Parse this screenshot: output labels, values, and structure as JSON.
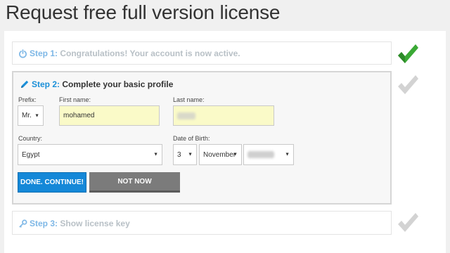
{
  "page": {
    "title": "Request free full version license"
  },
  "steps": {
    "step1": {
      "num": "Step 1:",
      "text": "Congratulations! Your account is now active.",
      "icon": "power-icon",
      "status": "completed"
    },
    "step2": {
      "num": "Step 2:",
      "text": "Complete your basic profile",
      "icon": "pencil-icon",
      "status": "active"
    },
    "step3": {
      "num": "Step 3:",
      "text": "Show license key",
      "icon": "key-icon",
      "status": "pending"
    }
  },
  "form": {
    "prefix": {
      "label": "Prefix:",
      "value": "Mr."
    },
    "first_name": {
      "label": "First name:",
      "value": "mohamed"
    },
    "last_name": {
      "label": "Last name:",
      "value": ""
    },
    "country": {
      "label": "Country:",
      "value": "Egypt"
    },
    "dob": {
      "label": "Date of Birth:",
      "day": "3",
      "month": "November",
      "year": ""
    }
  },
  "buttons": {
    "done": "DONE. CONTINUE!",
    "not_now": "NOT NOW"
  },
  "colors": {
    "accent": "#1488d8",
    "check_green": "#3aa935",
    "check_gray": "#d3d3d3",
    "input_highlight": "#fafac8"
  }
}
